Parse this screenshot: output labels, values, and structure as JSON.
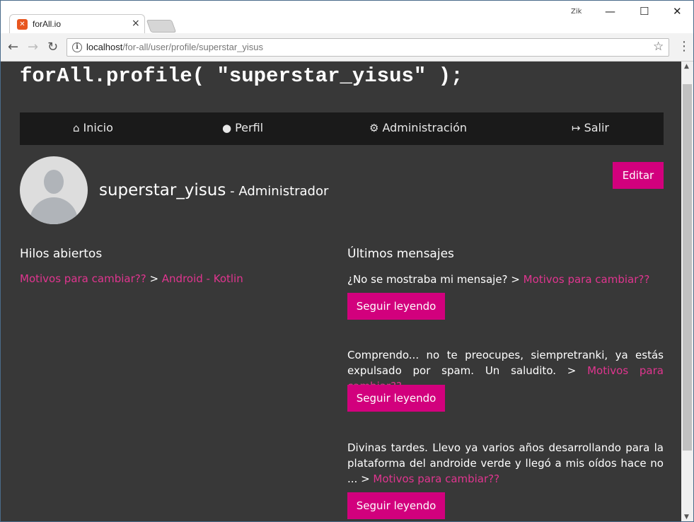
{
  "browser": {
    "tab_title": "forAll.io",
    "tab_close": "×",
    "favicon": "✕",
    "profile_icon": "Zik",
    "controls": {
      "minimize": "—",
      "maximize": "☐",
      "close": "✕"
    },
    "url_host": "localhost",
    "url_path": "/for-all/user/profile/superstar_yisus",
    "icons": {
      "back": "←",
      "forward": "→",
      "reload": "↻",
      "info": "i",
      "star": "☆",
      "menu": "⋮"
    }
  },
  "page": {
    "title": "forAll.profile( \"superstar_yisus\" );",
    "nav": [
      {
        "icon": "home-icon",
        "glyph": "⌂",
        "label": "Inicio"
      },
      {
        "icon": "user-circle-icon",
        "glyph": "●",
        "label": "Perfil"
      },
      {
        "icon": "gears-icon",
        "glyph": "⚙",
        "label": "Administración"
      },
      {
        "icon": "sign-out-icon",
        "glyph": "↦",
        "label": "Salir"
      }
    ],
    "user": {
      "name": "superstar_yisus",
      "separator": " - ",
      "role": "Administrador"
    },
    "edit_button": "Editar",
    "threads": {
      "heading": "Hilos abiertos",
      "items": [
        {
          "thread": "Motivos para cambiar??",
          "sep": " > ",
          "category": "Android - Kotlin"
        }
      ]
    },
    "messages": {
      "heading": "Últimos mensajes",
      "read_more": "Seguir leyendo",
      "items": [
        {
          "text": "¿No se mostraba mi mensaje? > ",
          "thread": "Motivos para cambiar??"
        },
        {
          "text": "Comprendo... no te preocupes, siempretranki, ya estás expulsado por spam. Un saludito. > ",
          "thread": "Motivos para cambiar??"
        },
        {
          "text": "Divinas tardes. Llevo ya varios años desarrollando para la plataforma del androide verde y llegó a mis oídos hace no ... > ",
          "thread": "Motivos para cambiar??"
        }
      ]
    }
  },
  "colors": {
    "accent": "#d2007d",
    "link": "#e0358f",
    "background": "#383838",
    "navbar": "#1a1a1a"
  }
}
